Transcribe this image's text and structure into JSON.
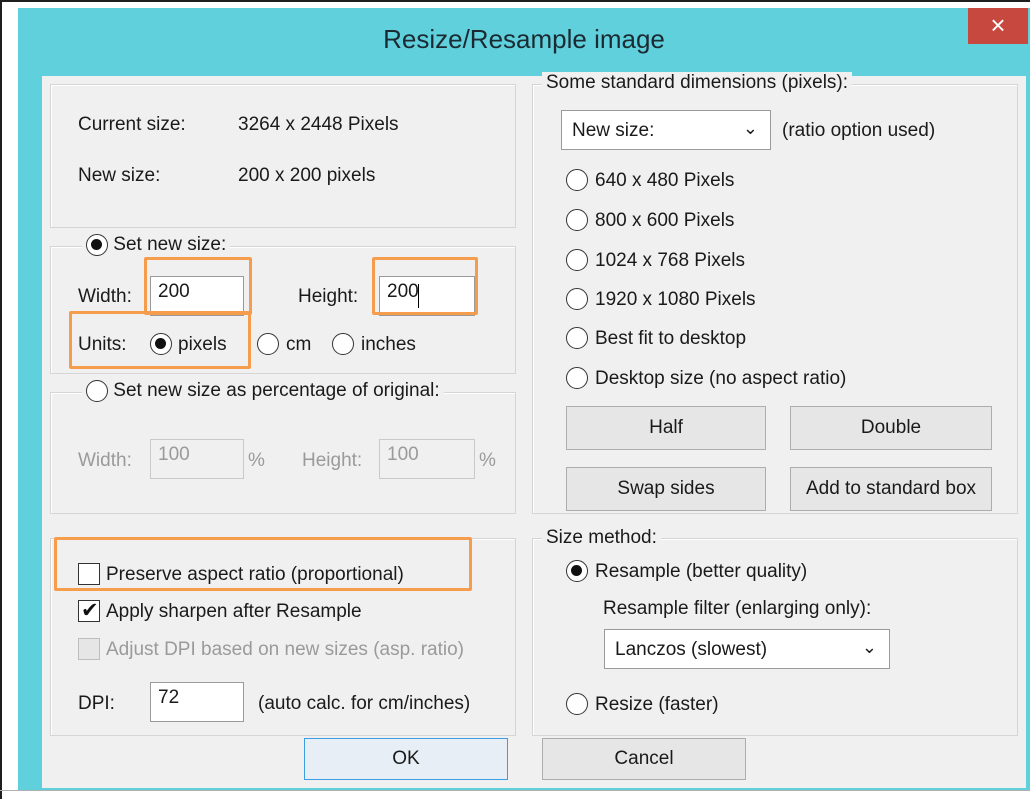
{
  "dialog": {
    "title": "Resize/Resample image",
    "close_glyph": "×"
  },
  "size_info": {
    "current_label": "Current size:",
    "current_value": "3264  x  2448  Pixels",
    "new_label": "New size:",
    "new_value": "200  x  200  pixels"
  },
  "set_new_size": {
    "label": "Set new size:",
    "selected": true,
    "width_label": "Width:",
    "width_value": "200",
    "height_label": "Height:",
    "height_value": "200",
    "units_label": "Units:",
    "units": [
      {
        "label": "pixels",
        "selected": true
      },
      {
        "label": "cm",
        "selected": false
      },
      {
        "label": "inches",
        "selected": false
      }
    ]
  },
  "percentage": {
    "label": "Set new size as percentage of original:",
    "selected": false,
    "width_label": "Width:",
    "width_value": "100",
    "width_unit": "%",
    "height_label": "Height:",
    "height_value": "100",
    "height_unit": "%"
  },
  "options": {
    "preserve_aspect": {
      "label": "Preserve aspect ratio (proportional)",
      "checked": false
    },
    "apply_sharpen": {
      "label": "Apply sharpen after Resample",
      "checked": true
    },
    "adjust_dpi": {
      "label": "Adjust DPI based on new sizes (asp. ratio)",
      "checked": false,
      "disabled": true
    },
    "dpi_label": "DPI:",
    "dpi_value": "72",
    "dpi_note": "(auto calc. for cm/inches)"
  },
  "standard_dimensions": {
    "legend": "Some standard dimensions (pixels):",
    "select_value": "New size:",
    "select_note": "(ratio option used)",
    "presets": [
      "640 x 480 Pixels",
      "800 x 600 Pixels",
      "1024 x 768 Pixels",
      "1920 x 1080 Pixels",
      "Best fit to desktop",
      "Desktop size (no aspect ratio)"
    ],
    "half_label": "Half",
    "double_label": "Double",
    "swap_label": "Swap sides",
    "add_label": "Add to standard box"
  },
  "size_method": {
    "legend": "Size method:",
    "resample_label": "Resample (better quality)",
    "resample_selected": true,
    "filter_label": "Resample filter (enlarging only):",
    "filter_value": "Lanczos (slowest)",
    "resize_label": "Resize (faster)",
    "resize_selected": false
  },
  "footer": {
    "ok_label": "OK",
    "cancel_label": "Cancel"
  },
  "colors": {
    "titlebar": "#5fd0dc",
    "close_button": "#c7483f",
    "highlight": "#f59d4c"
  }
}
